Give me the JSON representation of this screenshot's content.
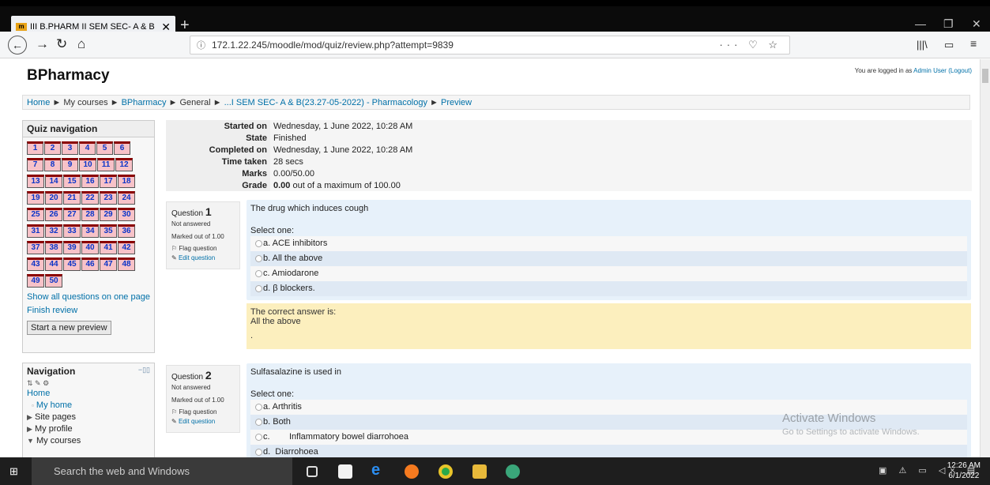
{
  "browser": {
    "tab_title": "III B.PHARM II SEM SEC- A & B",
    "url": "172.1.22.245/moodle/mod/quiz/review.php?attempt=9839"
  },
  "site": {
    "name": "BPharmacy",
    "login_prefix": "You are logged in as ",
    "login_user": "Admin User",
    "logout": "(Logout)"
  },
  "breadcrumb": [
    "Home",
    "My courses",
    "BPharmacy",
    "General",
    "...I SEM SEC- A & B(23.27-05-2022) - Pharmacology",
    "Preview"
  ],
  "quiz_nav": {
    "title": "Quiz navigation",
    "questions": [
      "1",
      "2",
      "3",
      "4",
      "5",
      "6",
      "7",
      "8",
      "9",
      "10",
      "11",
      "12",
      "13",
      "14",
      "15",
      "16",
      "17",
      "18",
      "19",
      "20",
      "21",
      "22",
      "23",
      "24",
      "25",
      "26",
      "27",
      "28",
      "29",
      "30",
      "31",
      "32",
      "33",
      "34",
      "35",
      "36",
      "37",
      "38",
      "39",
      "40",
      "41",
      "42",
      "43",
      "44",
      "45",
      "46",
      "47",
      "48",
      "49",
      "50"
    ],
    "show_all": "Show all questions on one page",
    "finish": "Finish review",
    "new_preview": "Start a new preview"
  },
  "navigation": {
    "title": "Navigation",
    "home": "Home",
    "my_home": "My home",
    "site_pages": "Site pages",
    "my_profile": "My profile",
    "my_courses": "My courses"
  },
  "summary": [
    {
      "key": "Started on",
      "value": "Wednesday, 1 June 2022, 10:28 AM"
    },
    {
      "key": "State",
      "value": "Finished"
    },
    {
      "key": "Completed on",
      "value": "Wednesday, 1 June 2022, 10:28 AM"
    },
    {
      "key": "Time taken",
      "value": "28 secs"
    },
    {
      "key": "Marks",
      "value": "0.00/50.00"
    },
    {
      "key": "Grade",
      "value_bold": "0.00",
      "value_rest": " out of a maximum of 100.00"
    }
  ],
  "questions": [
    {
      "label": "Question",
      "number": "1",
      "status": "Not answered",
      "marked": "Marked out of 1.00",
      "flag": "Flag question",
      "edit": "Edit question",
      "text": "The drug which induces cough",
      "select_one": "Select one:",
      "options": [
        "a. ACE inhibitors",
        "b. All the above",
        "c. Amiodarone",
        "d. β blockers."
      ],
      "feedback_intro": "The correct answer is:",
      "feedback_answer": "All the above",
      "feedback_dot": "."
    },
    {
      "label": "Question",
      "number": "2",
      "status": "Not answered",
      "marked": "Marked out of 1.00",
      "flag": "Flag question",
      "edit": "Edit question",
      "text": "Sulfasalazine is used in",
      "select_one": "Select one:",
      "options": [
        "a. Arthritis",
        "b. Both",
        "c.        Inflammatory bowel diarrohoea",
        "d.  Diarrohoea"
      ]
    }
  ],
  "watermark": {
    "title": "Activate Windows",
    "sub": "Go to Settings to activate Windows."
  },
  "taskbar": {
    "search_placeholder": "Search the web and Windows",
    "time": "12:26 AM",
    "date": "6/1/2022"
  }
}
